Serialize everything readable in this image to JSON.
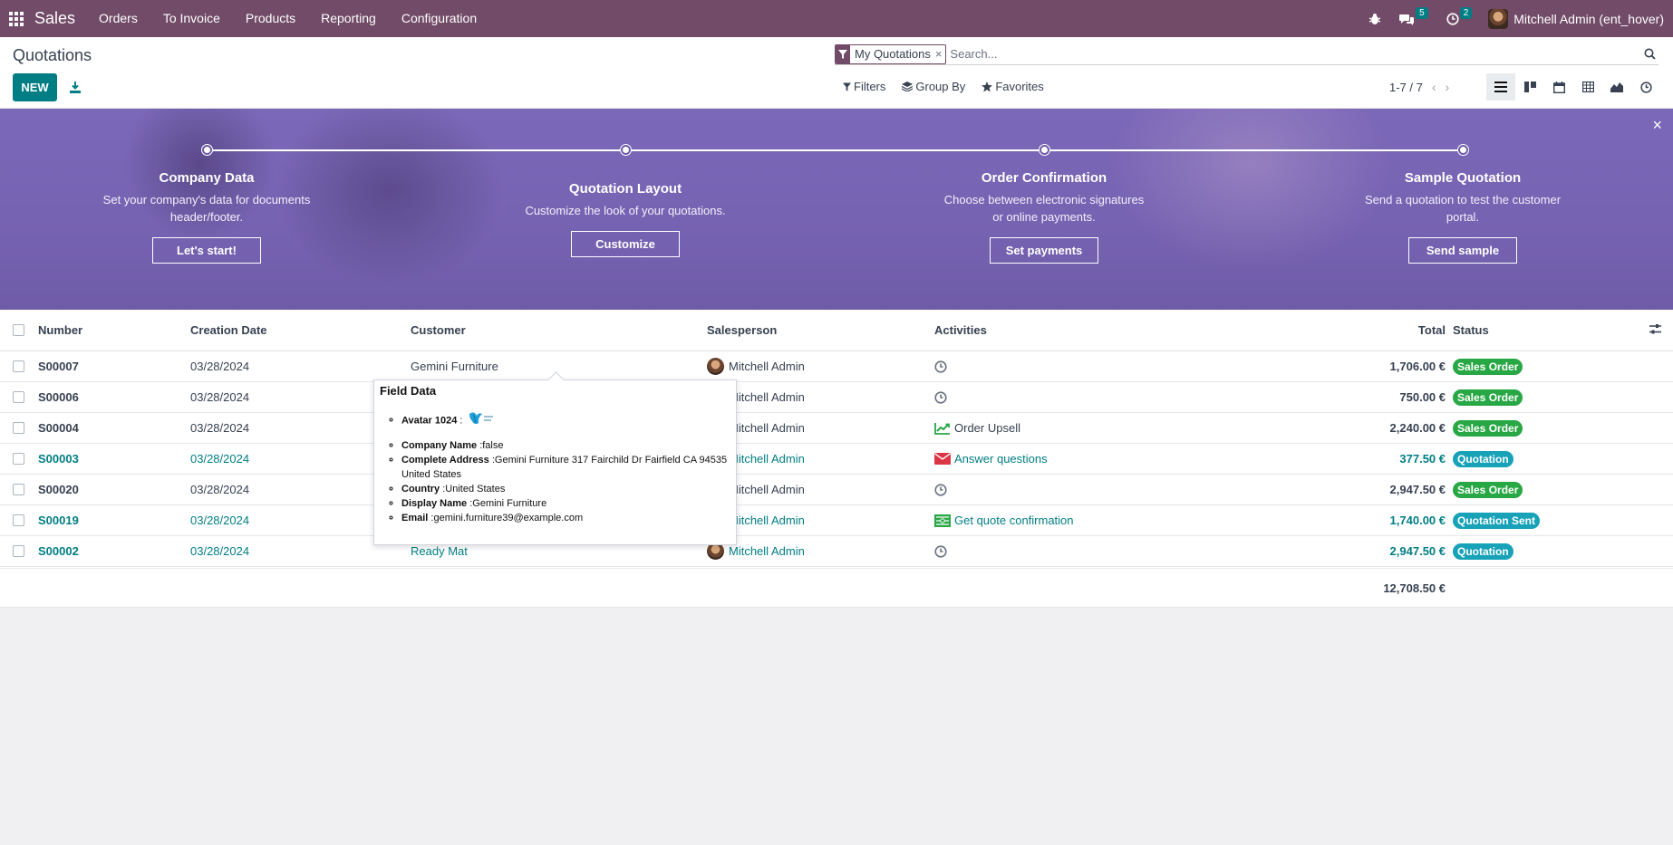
{
  "navbar": {
    "app_name": "Sales",
    "menu": [
      "Orders",
      "To Invoice",
      "Products",
      "Reporting",
      "Configuration"
    ],
    "messages_count": "5",
    "activities_count": "2",
    "user_name": "Mitchell Admin (ent_hover)",
    "color": "#714b67"
  },
  "control": {
    "title": "Quotations",
    "new_label": "NEW",
    "facet_label": "My Quotations",
    "facet_close": "×",
    "search_placeholder": "Search...",
    "filters_label": "Filters",
    "groupby_label": "Group By",
    "favorites_label": "Favorites",
    "pager": "1-7 / 7",
    "pager_prev": "‹",
    "pager_next": "›"
  },
  "banner": {
    "close": "×",
    "steps": [
      {
        "title": "Company Data",
        "text": "Set your company's data for documents header/footer.",
        "button": "Let's start!"
      },
      {
        "title": "Quotation Layout",
        "text": "Customize the look of your quotations.",
        "button": "Customize"
      },
      {
        "title": "Order Confirmation",
        "text": "Choose between electronic signatures or online payments.",
        "button": "Set payments"
      },
      {
        "title": "Sample Quotation",
        "text": "Send a quotation to test the customer portal.",
        "button": "Send sample"
      }
    ]
  },
  "table": {
    "headers": {
      "number": "Number",
      "date": "Creation Date",
      "customer": "Customer",
      "salesperson": "Salesperson",
      "activities": "Activities",
      "total": "Total",
      "status": "Status"
    },
    "rows": [
      {
        "number": "S00007",
        "date": "03/28/2024",
        "customer": "Gemini Furniture",
        "salesperson": "Mitchell Admin",
        "activity": "",
        "activity_icon": "clock-icon",
        "total": "1,706.00 €",
        "status": "Sales Order",
        "status_color": "#28a745"
      },
      {
        "number": "S00006",
        "date": "03/28/2024",
        "customer": "",
        "salesperson": "Mitchell Admin",
        "activity": "",
        "activity_icon": "clock-icon",
        "total": "750.00 €",
        "status": "Sales Order",
        "status_color": "#28a745"
      },
      {
        "number": "S00004",
        "date": "03/28/2024",
        "customer": "",
        "salesperson": "Mitchell Admin",
        "activity": "Order Upsell",
        "activity_icon": "chart-line-icon",
        "total": "2,240.00 €",
        "status": "Sales Order",
        "status_color": "#28a745"
      },
      {
        "number": "S00003",
        "date": "03/28/2024",
        "customer": "",
        "salesperson": "Mitchell Admin",
        "activity": "Answer questions",
        "activity_icon": "envelope-icon",
        "total": "377.50 €",
        "status": "Quotation",
        "status_color": "#17a2b8"
      },
      {
        "number": "S00020",
        "date": "03/28/2024",
        "customer": "",
        "salesperson": "Mitchell Admin",
        "activity": "",
        "activity_icon": "clock-icon",
        "total": "2,947.50 €",
        "status": "Sales Order",
        "status_color": "#28a745"
      },
      {
        "number": "S00019",
        "date": "03/28/2024",
        "customer": "",
        "salesperson": "Mitchell Admin",
        "activity": "Get quote confirmation",
        "activity_icon": "money-icon",
        "total": "1,740.00 €",
        "status": "Quotation Sent",
        "status_color": "#17a2b8"
      },
      {
        "number": "S00002",
        "date": "03/28/2024",
        "customer": "Ready Mat",
        "salesperson": "Mitchell Admin",
        "activity": "",
        "activity_icon": "clock-icon",
        "total": "2,947.50 €",
        "status": "Quotation",
        "status_color": "#17a2b8"
      }
    ],
    "grand_total": "12,708.50 €"
  },
  "popover": {
    "title": "Field Data",
    "avatar_label": "Avatar 1024",
    "avatar_sep": " :",
    "fields": [
      {
        "label": "Company Name",
        "value": " :false"
      },
      {
        "label": "Complete Address",
        "value": " :Gemini Furniture 317 Fairchild Dr Fairfield CA 94535 United States"
      },
      {
        "label": "Country",
        "value": " :United States"
      },
      {
        "label": "Display Name",
        "value": " :Gemini Furniture"
      },
      {
        "label": "Email",
        "value": " :gemini.furniture39@example.com"
      }
    ]
  }
}
